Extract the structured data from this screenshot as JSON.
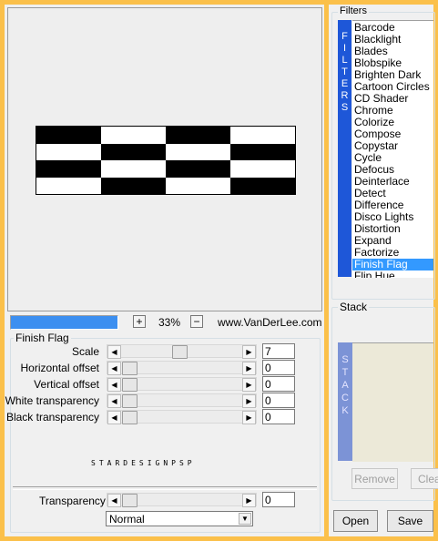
{
  "preview": {
    "zoom": "33%",
    "zoom_in": "+",
    "zoom_out": "−",
    "credit": "www.VanDerLee.com",
    "progress": 1.0
  },
  "filters": {
    "title": "Filters",
    "tab_letters": [
      "F",
      "I",
      "L",
      "T",
      "E",
      "R",
      "S"
    ],
    "items": [
      "Barcode",
      "Blacklight",
      "Blades",
      "Blobspike",
      "Brighten Dark",
      "Cartoon Circles",
      "CD Shader",
      "Chrome",
      "Colorize",
      "Compose",
      "Copystar",
      "Cycle",
      "Defocus",
      "Deinterlace",
      "Detect",
      "Difference",
      "Disco Lights",
      "Distortion",
      "Expand",
      "Factorize",
      "Finish Flag",
      "Flip Hue"
    ],
    "selected": "Finish Flag"
  },
  "stack": {
    "title": "Stack",
    "tab_letters": [
      "S",
      "T",
      "A",
      "C",
      "K"
    ],
    "remove_label": "Remove",
    "clear_label": "Clear"
  },
  "settings": {
    "title": "Finish Flag",
    "params": [
      {
        "label": "Scale",
        "value": "7",
        "level": 0.47
      },
      {
        "label": "Horizontal offset",
        "value": "0",
        "level": 0
      },
      {
        "label": "Vertical offset",
        "value": "0",
        "level": 0
      },
      {
        "label": "White transparency",
        "value": "0",
        "level": 0
      },
      {
        "label": "Black transparency",
        "value": "0",
        "level": 0
      }
    ],
    "watermark": "STARDESIGNPSP",
    "transparency": {
      "label": "Transparency",
      "value": "0",
      "level": 0
    },
    "blend_mode": "Normal"
  },
  "actions": {
    "open_label": "Open",
    "save_label": "Save"
  }
}
